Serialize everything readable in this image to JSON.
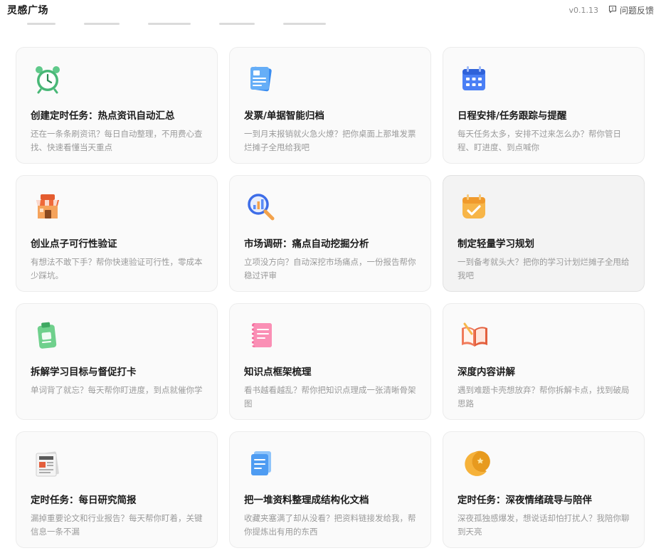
{
  "header": {
    "title": "灵感广场",
    "version": "v0.1.13",
    "feedback_label": "问题反馈"
  },
  "cards": [
    {
      "icon": "alarm-clock-icon",
      "title": "创建定时任务：热点资讯自动汇总",
      "desc": "还在一条条刷资讯？每日自动整理，不用费心查找、快速看懂当天重点"
    },
    {
      "icon": "invoice-document-icon",
      "title": "发票/单据智能归档",
      "desc": "一到月末报销就火急火燎？把你桌面上那堆发票烂摊子全甩给我吧"
    },
    {
      "icon": "calendar-icon",
      "title": "日程安排/任务跟踪与提醒",
      "desc": "每天任务太多，安排不过来怎么办？帮你管日程、盯进度、到点喊你"
    },
    {
      "icon": "store-icon",
      "title": "创业点子可行性验证",
      "desc": "有想法不敢下手？帮你快速验证可行性，零成本少踩坑。"
    },
    {
      "icon": "magnifier-chart-icon",
      "title": "市场调研：痛点自动挖掘分析",
      "desc": "立项没方向？自动深挖市场痛点，一份报告帮你稳过评审"
    },
    {
      "icon": "checklist-calendar-icon",
      "title": "制定轻量学习规划",
      "desc": "一到备考就头大？把你的学习计划烂摊子全甩给我吧"
    },
    {
      "icon": "clipboard-icon",
      "title": "拆解学习目标与督促打卡",
      "desc": "单词背了就忘？每天帮你盯进度，到点就催你学"
    },
    {
      "icon": "notebook-icon",
      "title": "知识点框架梳理",
      "desc": "看书越看越乱？帮你把知识点理成一张清晰骨架图"
    },
    {
      "icon": "open-book-icon",
      "title": "深度内容讲解",
      "desc": "遇到难题卡壳想放弃？帮你拆解卡点，找到破局思路"
    },
    {
      "icon": "newspaper-icon",
      "title": "定时任务：每日研究简报",
      "desc": "漏掉重要论文和行业报告？每天帮你盯着，关键信息一条不漏"
    },
    {
      "icon": "documents-stack-icon",
      "title": "把一堆资料整理成结构化文档",
      "desc": "收藏夹塞满了却从没看？把资料链接发给我，帮你提炼出有用的东西"
    },
    {
      "icon": "moon-star-icon",
      "title": "定时任务：深夜情绪疏导与陪伴",
      "desc": "深夜孤独感爆发，想说话却怕打扰人？我陪你聊到天亮"
    }
  ]
}
